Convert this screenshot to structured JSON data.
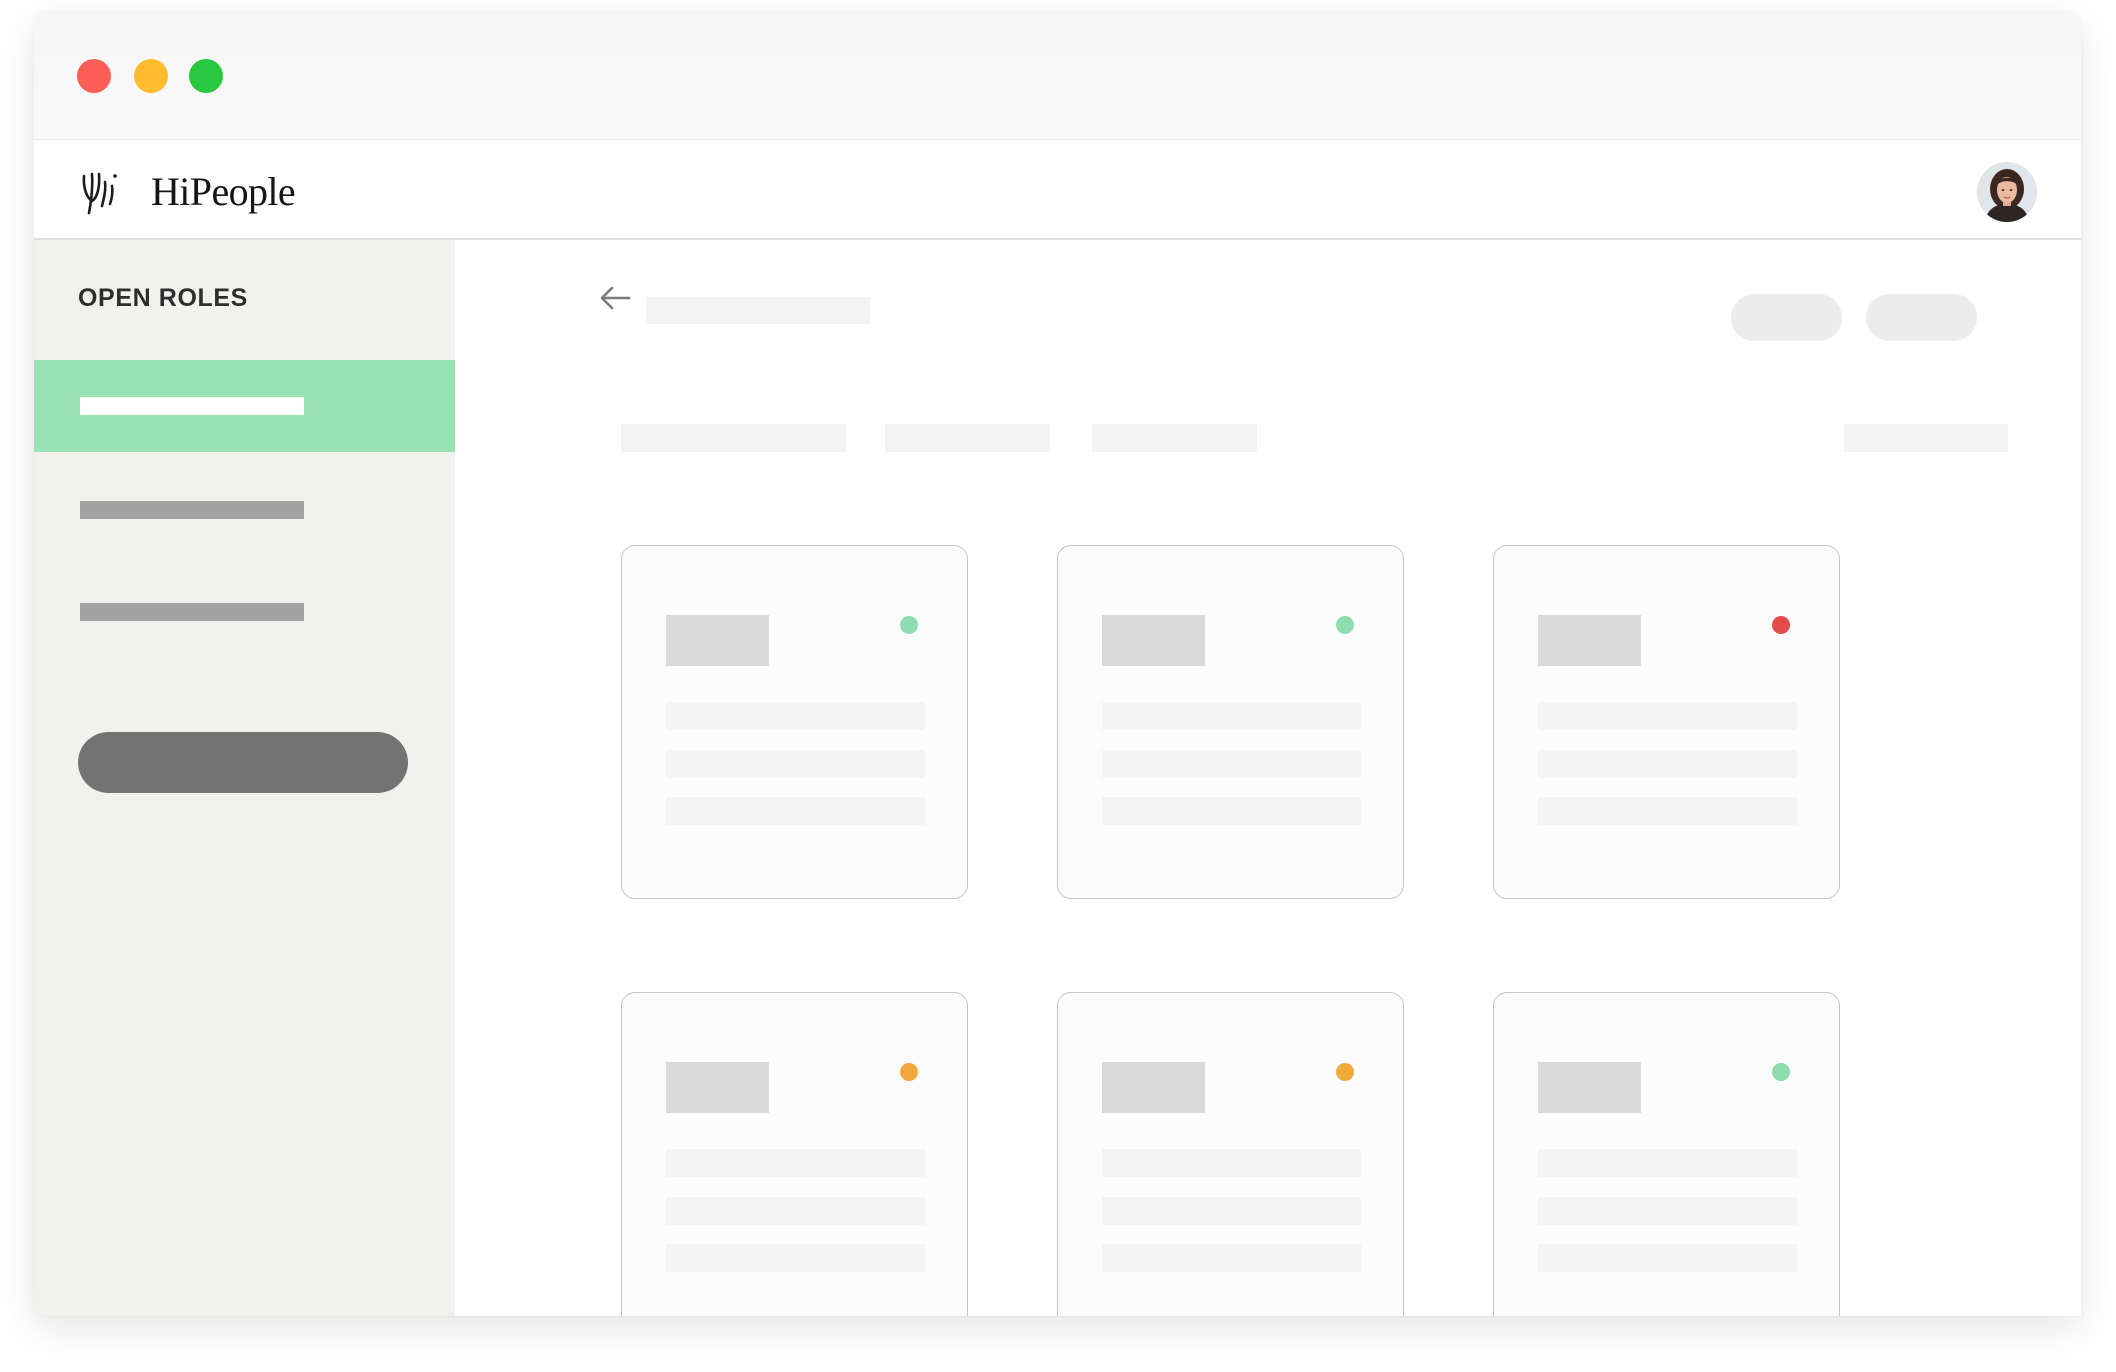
{
  "app": {
    "name": "HiPeople",
    "logo_icon": "hipeople-logo-icon"
  },
  "header": {
    "avatar_icon": "user-avatar"
  },
  "sidebar": {
    "heading": "OPEN ROLES"
  },
  "main": {
    "back_icon": "arrow-left-icon"
  },
  "colors": {
    "accent": "#98e2b4",
    "sidebar_background": "#f1f1ed",
    "primary_button": "#737373",
    "status_active": "#8fdcb1",
    "status_warning": "#f0a93a",
    "status_closed": "#e54b4b"
  },
  "cards": [
    {
      "status_color": "#8fdcb1"
    },
    {
      "status_color": "#8fdcb1"
    },
    {
      "status_color": "#e54b4b"
    },
    {
      "status_color": "#f0a93a"
    },
    {
      "status_color": "#f0a93a"
    },
    {
      "status_color": "#8fdcb1"
    }
  ]
}
